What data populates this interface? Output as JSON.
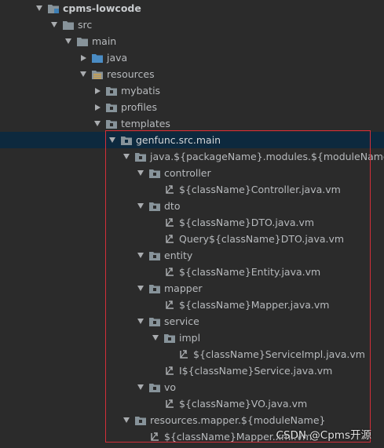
{
  "tree": [
    {
      "label": "cpms-lowcode",
      "arrow": "down",
      "icon": "module-folder-icon",
      "bold": true
    },
    {
      "label": "src",
      "arrow": "down",
      "icon": "folder-icon"
    },
    {
      "label": "main",
      "arrow": "down",
      "icon": "folder-icon"
    },
    {
      "label": "java",
      "arrow": "right",
      "icon": "source-folder-icon"
    },
    {
      "label": "resources",
      "arrow": "down",
      "icon": "resources-folder-icon"
    },
    {
      "label": "mybatis",
      "arrow": "right",
      "icon": "package-folder-icon"
    },
    {
      "label": "profiles",
      "arrow": "right",
      "icon": "package-folder-icon"
    },
    {
      "label": "templates",
      "arrow": "down",
      "icon": "package-folder-icon"
    },
    {
      "label": "genfunc.src.main",
      "arrow": "down",
      "icon": "package-folder-icon",
      "selected": true
    },
    {
      "label": "java.${packageName}.modules.${moduleName}",
      "arrow": "down",
      "icon": "package-folder-icon"
    },
    {
      "label": "controller",
      "arrow": "down",
      "icon": "package-folder-icon"
    },
    {
      "label": "${className}Controller.java.vm",
      "arrow": "none",
      "icon": "velocity-file-icon"
    },
    {
      "label": "dto",
      "arrow": "down",
      "icon": "package-folder-icon"
    },
    {
      "label": "${className}DTO.java.vm",
      "arrow": "none",
      "icon": "velocity-file-icon"
    },
    {
      "label": "Query${className}DTO.java.vm",
      "arrow": "none",
      "icon": "velocity-file-icon"
    },
    {
      "label": "entity",
      "arrow": "down",
      "icon": "package-folder-icon"
    },
    {
      "label": "${className}Entity.java.vm",
      "arrow": "none",
      "icon": "velocity-file-icon"
    },
    {
      "label": "mapper",
      "arrow": "down",
      "icon": "package-folder-icon"
    },
    {
      "label": "${className}Mapper.java.vm",
      "arrow": "none",
      "icon": "velocity-file-icon"
    },
    {
      "label": "service",
      "arrow": "down",
      "icon": "package-folder-icon"
    },
    {
      "label": "impl",
      "arrow": "down",
      "icon": "package-folder-icon"
    },
    {
      "label": "${className}ServiceImpl.java.vm",
      "arrow": "none",
      "icon": "velocity-file-icon"
    },
    {
      "label": "I${className}Service.java.vm",
      "arrow": "none",
      "icon": "velocity-file-icon"
    },
    {
      "label": "vo",
      "arrow": "down",
      "icon": "package-folder-icon"
    },
    {
      "label": "${className}VO.java.vm",
      "arrow": "none",
      "icon": "velocity-file-icon"
    },
    {
      "label": "resources.mapper.${moduleName}",
      "arrow": "down",
      "icon": "package-folder-icon"
    },
    {
      "label": "${className}Mapper.xml.vm",
      "arrow": "none",
      "icon": "velocity-file-icon"
    }
  ],
  "watermark": "CSDN @Cpms开源"
}
